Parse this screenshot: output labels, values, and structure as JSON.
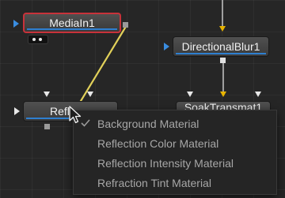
{
  "nodes": {
    "media_in": {
      "label": "MediaIn1"
    },
    "directional_blur": {
      "label": "DirectionalBlur1"
    },
    "reflect": {
      "label": "Refl"
    },
    "soak": {
      "label": "SoakTransmat1"
    }
  },
  "context_menu": {
    "items": [
      {
        "label": "Background Material",
        "checked": true
      },
      {
        "label": "Reflection Color Material",
        "checked": false
      },
      {
        "label": "Reflection Intensity Material",
        "checked": false
      },
      {
        "label": "Refraction Tint Material",
        "checked": false
      }
    ]
  },
  "colors": {
    "selected_node_border": "#c8323a",
    "connection_line": "#e2d15a",
    "input_arrow_blue": "#3a8de0",
    "input_arrow_orange": "#e8b400",
    "node_underline": "#2e7fd0"
  },
  "icons": {
    "cursor": "mouse-pointer-icon",
    "check": "checkmark-icon"
  }
}
